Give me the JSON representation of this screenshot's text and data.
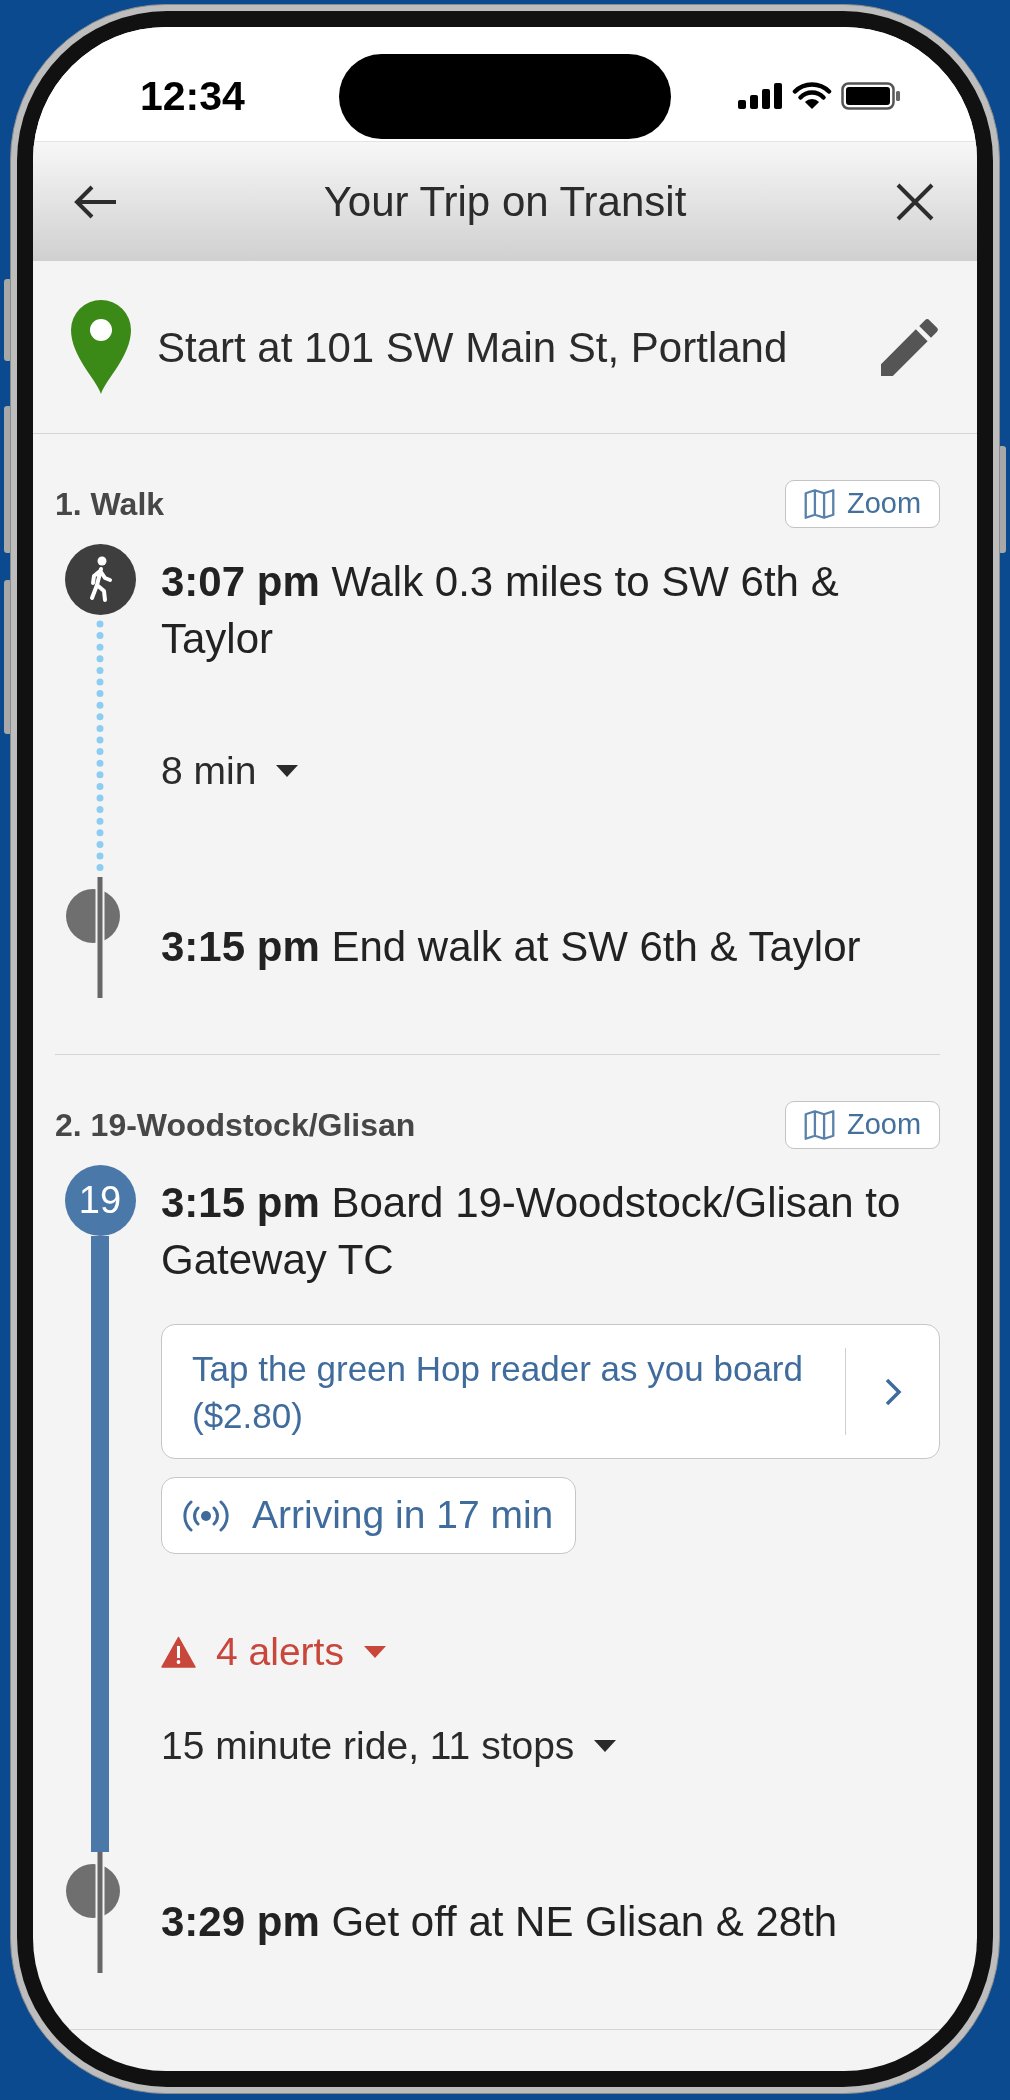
{
  "status_bar": {
    "time": "12:34"
  },
  "header": {
    "title": "Your Trip on Transit"
  },
  "start": {
    "text": "Start at 101 SW Main St, Portland"
  },
  "legs": [
    {
      "kind": "walk",
      "title": "1. Walk",
      "zoom_button": {
        "label": "Zoom"
      },
      "board": {
        "text": "**3:07 pm** Walk 0.3 miles to SW 6th & Taylor"
      },
      "details": [
        {
          "kind": "duration",
          "text": "8 min",
          "expanded": false
        }
      ],
      "end": {
        "text": "**3:15 pm** End walk at SW 6th & Taylor"
      }
    },
    {
      "kind": "bus",
      "title": "2. 19-Woodstock/Glisan",
      "zoom_button": {
        "label": "Zoom"
      },
      "route": "19",
      "board": {
        "text": "**3:15 pm** Board 19-Woodstock/Glisan to Gateway TC"
      },
      "fare": {
        "text": "Tap the green Hop reader as you board ($2.80)"
      },
      "realtime": {
        "text": "Arriving in 17 min"
      },
      "details": [
        {
          "kind": "alerts",
          "text": "4 alerts",
          "expanded": false
        },
        {
          "kind": "stops",
          "text": "15 minute ride, 11 stops",
          "expanded": false
        }
      ],
      "end": {
        "text": "**3:29 pm** Get off at NE Glisan & 28th"
      }
    }
  ]
}
